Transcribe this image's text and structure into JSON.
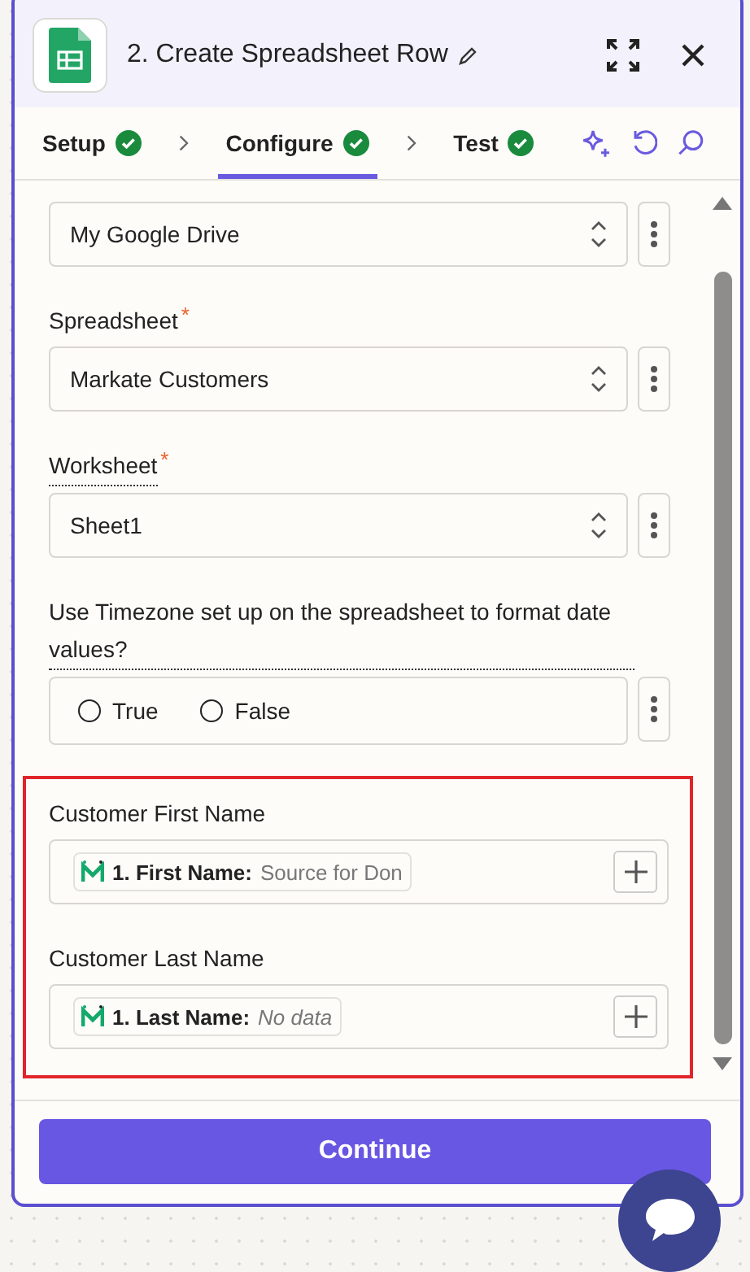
{
  "header": {
    "title": "2. Create Spreadsheet Row"
  },
  "steps": [
    {
      "label": "Setup",
      "selected": false,
      "done": true
    },
    {
      "label": "Configure",
      "selected": true,
      "done": true
    },
    {
      "label": "Test",
      "selected": false,
      "done": true
    }
  ],
  "fields": [
    {
      "kind": "select",
      "value": "My Google Drive"
    },
    {
      "kind": "select",
      "label": "Spreadsheet",
      "required_mark": "*",
      "dotted_underline": false,
      "value": "Markate Customers"
    },
    {
      "kind": "select",
      "label": "Worksheet",
      "required_mark": "*",
      "dotted_underline": true,
      "value": "Sheet1"
    },
    {
      "kind": "radio",
      "label": "Use Timezone set up on the spreadsheet to format date values?",
      "dotted_underline": true,
      "options": [
        {
          "label": "True",
          "selected": false
        },
        {
          "label": "False",
          "selected": false
        }
      ]
    }
  ],
  "highlighted_fields": [
    {
      "kind": "mapped",
      "label": "Customer First Name",
      "step": "1. First Name:",
      "value": "Source for Don",
      "empty": false
    },
    {
      "kind": "mapped",
      "label": "Customer Last Name",
      "step": "1. Last Name:",
      "value": "No data",
      "empty": true
    }
  ],
  "continue_button": "Continue"
}
